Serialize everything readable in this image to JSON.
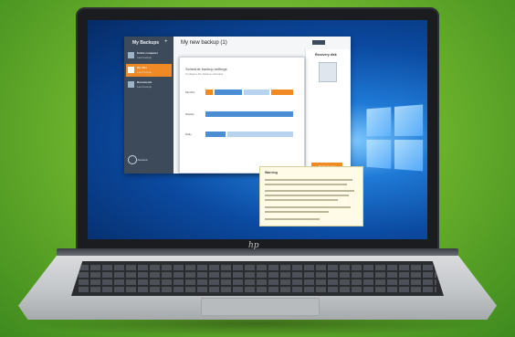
{
  "sidebar": {
    "title": "My Backups",
    "items": [
      {
        "label": "Entire computer",
        "sub": "Last backup"
      },
      {
        "label": "My files",
        "sub": "Last backup"
      },
      {
        "label": "Documents",
        "sub": "Last backup"
      }
    ],
    "account_label": "Account"
  },
  "header": {
    "title": "My new backup (1)"
  },
  "dialog": {
    "heading": "Schedule backup settings",
    "subheading": "Configure the backup schedule",
    "rows": [
      "Monthly",
      "Weekly",
      "Daily"
    ]
  },
  "right_panel": {
    "title": "Recovery disk",
    "button_label": "Back up now"
  },
  "tip": {
    "title": "Warning"
  },
  "brand": {
    "logo": "hp"
  },
  "colors": {
    "accent": "#f08a24",
    "sidebar": "#3c4a5a",
    "desktop": "#0b4aa1",
    "background": "#6fb52e"
  }
}
